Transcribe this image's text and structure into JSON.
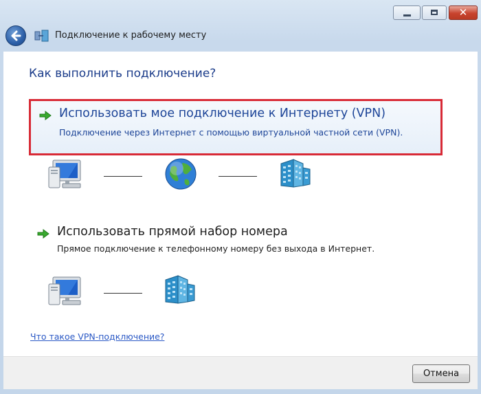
{
  "window": {
    "title": "Подключение к рабочему месту",
    "controls": {
      "minimize": "minimize",
      "maximize": "maximize",
      "close": "✕"
    }
  },
  "main": {
    "heading": "Как выполнить подключение?",
    "options": [
      {
        "title": "Использовать мое подключение к Интернету (VPN)",
        "description": "Подключение через Интернет с помощью виртуальной частной сети (VPN).",
        "selected": true,
        "diagram_icons": [
          "computer-icon",
          "globe-icon",
          "office-building-icon"
        ]
      },
      {
        "title": "Использовать прямой набор номера",
        "description": "Прямое подключение к телефонному номеру без выхода в Интернет.",
        "selected": false,
        "diagram_icons": [
          "computer-icon",
          "office-building-icon"
        ]
      }
    ],
    "help_link": "Что такое VPN-подключение?"
  },
  "footer": {
    "cancel_label": "Отмена"
  },
  "colors": {
    "heading": "#1b3c8a",
    "selection_border": "#d82a36",
    "link": "#2a58c5",
    "arrow_green": "#2f9e2a"
  }
}
